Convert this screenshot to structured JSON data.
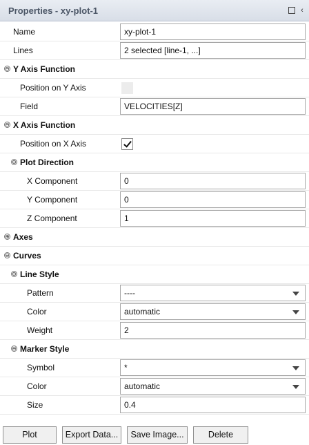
{
  "panel": {
    "title": "Properties - xy-plot-1"
  },
  "props": {
    "name_label": "Name",
    "name_value": "xy-plot-1",
    "lines_label": "Lines",
    "lines_value": "2 selected [line-1, ...]",
    "y_axis_function": "Y Axis Function",
    "pos_y_label": "Position on Y Axis",
    "pos_y_checked": false,
    "field_label": "Field",
    "field_value": "VELOCITIES[Z]",
    "x_axis_function": "X Axis Function",
    "pos_x_label": "Position on X Axis",
    "pos_x_checked": true,
    "plot_direction": "Plot Direction",
    "x_comp_label": "X Component",
    "x_comp_value": "0",
    "y_comp_label": "Y Component",
    "y_comp_value": "0",
    "z_comp_label": "Z Component",
    "z_comp_value": "1",
    "axes": "Axes",
    "curves": "Curves",
    "line_style": "Line Style",
    "pattern_label": "Pattern",
    "pattern_value": "----",
    "line_color_label": "Color",
    "line_color_value": "automatic",
    "weight_label": "Weight",
    "weight_value": "2",
    "marker_style": "Marker Style",
    "symbol_label": "Symbol",
    "symbol_value": "*",
    "marker_color_label": "Color",
    "marker_color_value": "automatic",
    "size_label": "Size",
    "size_value": "0.4"
  },
  "toggles": {
    "expanded": "⊖",
    "collapsed": "⊕"
  },
  "buttons": {
    "plot": "Plot",
    "export": "Export Data...",
    "save": "Save Image...",
    "delete": "Delete"
  },
  "icons": {
    "float": "float-window-icon",
    "collapse": "chevron-left-icon"
  }
}
